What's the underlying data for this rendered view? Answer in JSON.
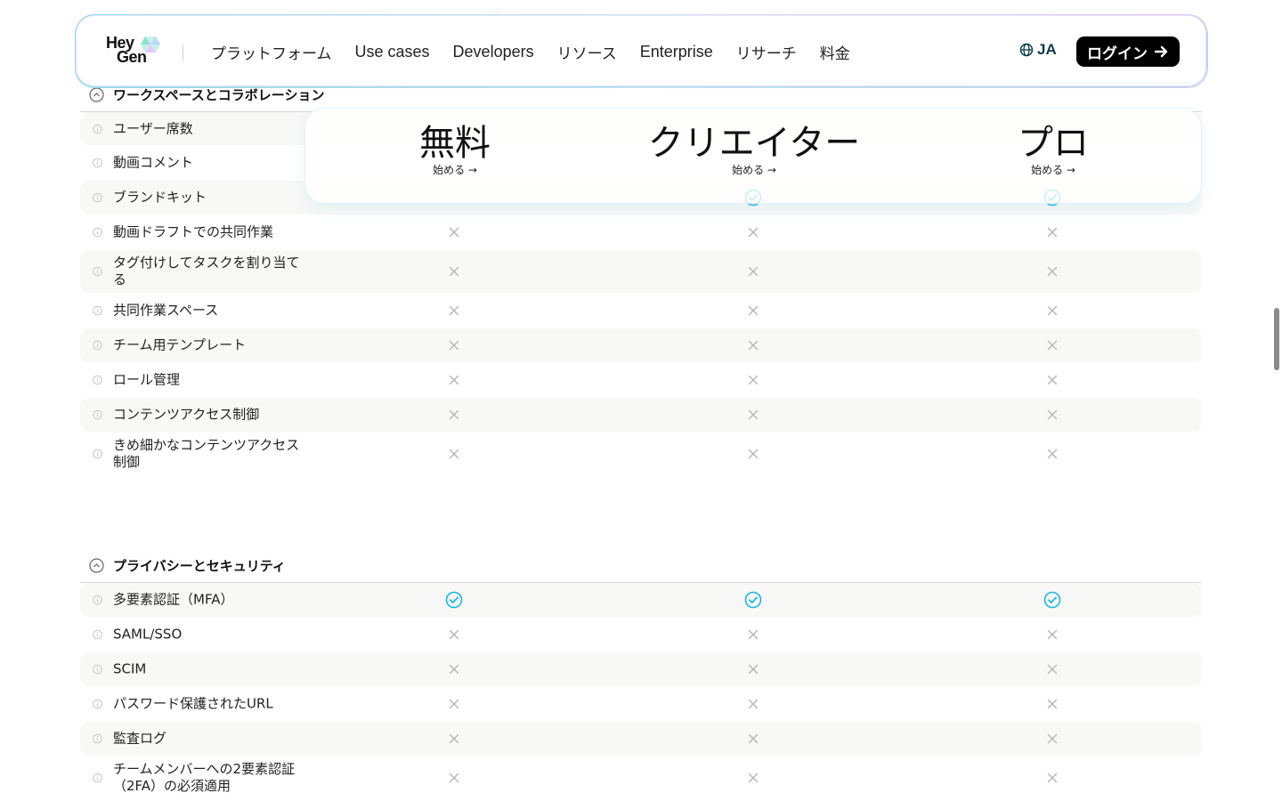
{
  "nav": {
    "logo_line1": "Hey",
    "logo_line2": "Gen",
    "items": [
      {
        "label": "プラットフォーム",
        "en": false
      },
      {
        "label": "Use cases",
        "en": true
      },
      {
        "label": "Developers",
        "en": true
      },
      {
        "label": "リソース",
        "en": false
      },
      {
        "label": "Enterprise",
        "en": true
      },
      {
        "label": "リサーチ",
        "en": false
      },
      {
        "label": "料金",
        "en": false
      }
    ],
    "lang": "JA",
    "login": "ログイン"
  },
  "plans": [
    {
      "name": "無料",
      "cta": "始める →"
    },
    {
      "name": "クリエイター",
      "cta": "始める →"
    },
    {
      "name": "プロ",
      "cta": "始める →"
    }
  ],
  "sections": [
    {
      "title": "ワークスペースとコラボレーション",
      "rows": [
        {
          "label": "ユーザー席数",
          "values": [
            "",
            "",
            ""
          ]
        },
        {
          "label": "動画コメント",
          "values": [
            "",
            "",
            ""
          ]
        },
        {
          "label": "ブランドキット",
          "values": [
            "",
            "check",
            "check"
          ]
        },
        {
          "label": "動画ドラフトでの共同作業",
          "values": [
            "cross",
            "cross",
            "cross"
          ]
        },
        {
          "label": "タグ付けしてタスクを割り当てる",
          "values": [
            "cross",
            "cross",
            "cross"
          ]
        },
        {
          "label": "共同作業スペース",
          "values": [
            "cross",
            "cross",
            "cross"
          ]
        },
        {
          "label": "チーム用テンプレート",
          "values": [
            "cross",
            "cross",
            "cross"
          ]
        },
        {
          "label": "ロール管理",
          "values": [
            "cross",
            "cross",
            "cross"
          ]
        },
        {
          "label": "コンテンツアクセス制御",
          "values": [
            "cross",
            "cross",
            "cross"
          ]
        },
        {
          "label": "きめ細かなコンテンツアクセス制御",
          "values": [
            "cross",
            "cross",
            "cross"
          ]
        }
      ]
    },
    {
      "title": "プライバシーとセキュリティ",
      "rows": [
        {
          "label": "多要素認証（MFA）",
          "values": [
            "check",
            "check",
            "check"
          ]
        },
        {
          "label": "SAML/SSO",
          "values": [
            "cross",
            "cross",
            "cross"
          ]
        },
        {
          "label": "SCIM",
          "values": [
            "cross",
            "cross",
            "cross"
          ]
        },
        {
          "label": "パスワード保護されたURL",
          "values": [
            "cross",
            "cross",
            "cross"
          ]
        },
        {
          "label": "監査ログ",
          "values": [
            "cross",
            "cross",
            "cross"
          ]
        },
        {
          "label": "チームメンバーへの2要素認証（2FA）の必須適用",
          "values": [
            "cross",
            "cross",
            "cross"
          ]
        }
      ]
    }
  ],
  "colors": {
    "check": "#1fb6e0",
    "cross": "#b5b5b5",
    "login_bg": "#000000"
  }
}
